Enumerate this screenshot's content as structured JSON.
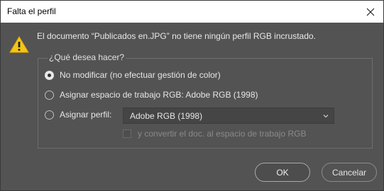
{
  "window": {
    "title": "Falta el perfil"
  },
  "dialog": {
    "message": "El documento “Publicados en.JPG” no tiene ningún perfil RGB incrustado.",
    "icon": "warning-icon"
  },
  "options": {
    "legend": "¿Qué desea hacer?",
    "radios": [
      {
        "label": "No modificar (no efectuar gestión de color)",
        "checked": true
      },
      {
        "label": "Asignar espacio de trabajo RGB: Adobe RGB (1998)",
        "checked": false
      },
      {
        "label": "Asignar perfil:",
        "checked": false
      }
    ],
    "profile_select": {
      "value": "Adobe RGB (1998)"
    },
    "convert_checkbox": {
      "label": "y convertir el doc. al espacio de trabajo RGB",
      "checked": false,
      "enabled": false
    }
  },
  "buttons": {
    "ok": "OK",
    "cancel": "Cancelar"
  },
  "colors": {
    "background": "#535353",
    "titlebar": "#ffffff",
    "warning": "#f5c518"
  }
}
